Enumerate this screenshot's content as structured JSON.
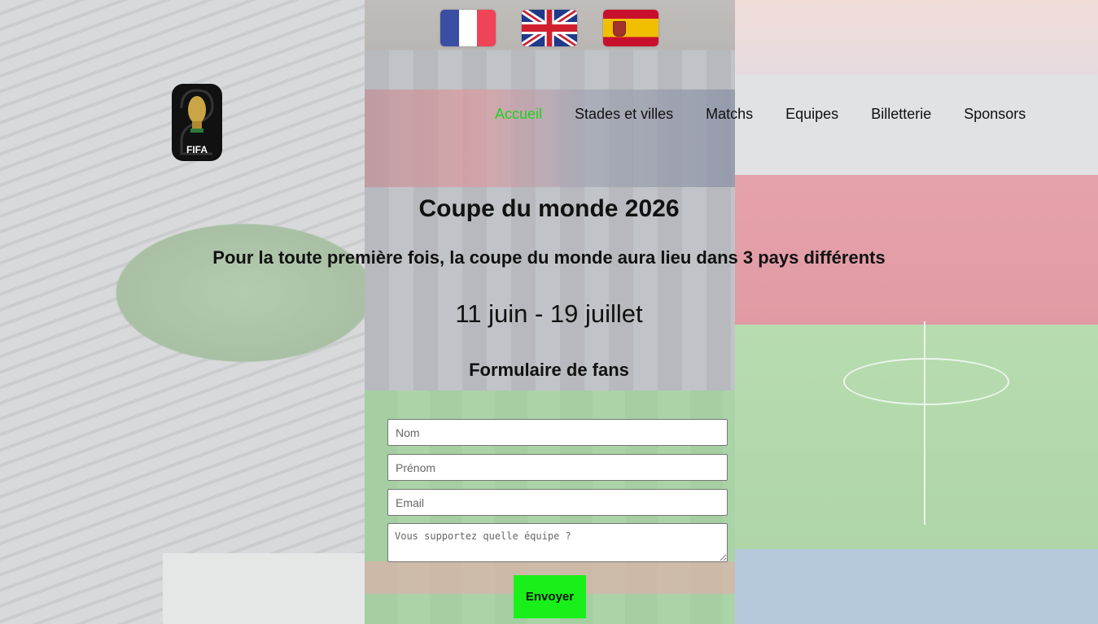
{
  "flags": [
    {
      "name": "france-flag-icon",
      "colors": [
        "#3a4fa3",
        "#ffffff",
        "#ef4458"
      ]
    },
    {
      "name": "uk-flag-icon",
      "colors": [
        "#1f3a8a",
        "#ffffff",
        "#d0202e"
      ]
    },
    {
      "name": "spain-flag-icon",
      "colors": [
        "#c8102e",
        "#f1bf00"
      ]
    }
  ],
  "logo": {
    "text": "FIFA"
  },
  "nav": {
    "items": [
      "Accueil",
      "Stades et villes",
      "Matchs",
      "Equipes",
      "Billetterie",
      "Sponsors"
    ],
    "active_color": "#1fd11f"
  },
  "hero": {
    "title": "Coupe du monde 2026",
    "subtitle": "Pour la toute première fois, la coupe du monde aura lieu dans 3 pays différents",
    "dates": "11 juin - 19 juillet"
  },
  "form": {
    "title": "Formulaire de fans",
    "nom_placeholder": "Nom",
    "prenom_placeholder": "Prénom",
    "email_placeholder": "Email",
    "team_placeholder": "Vous supportez quelle équipe ?",
    "submit_label": "Envoyer",
    "submit_color": "#19f019"
  }
}
